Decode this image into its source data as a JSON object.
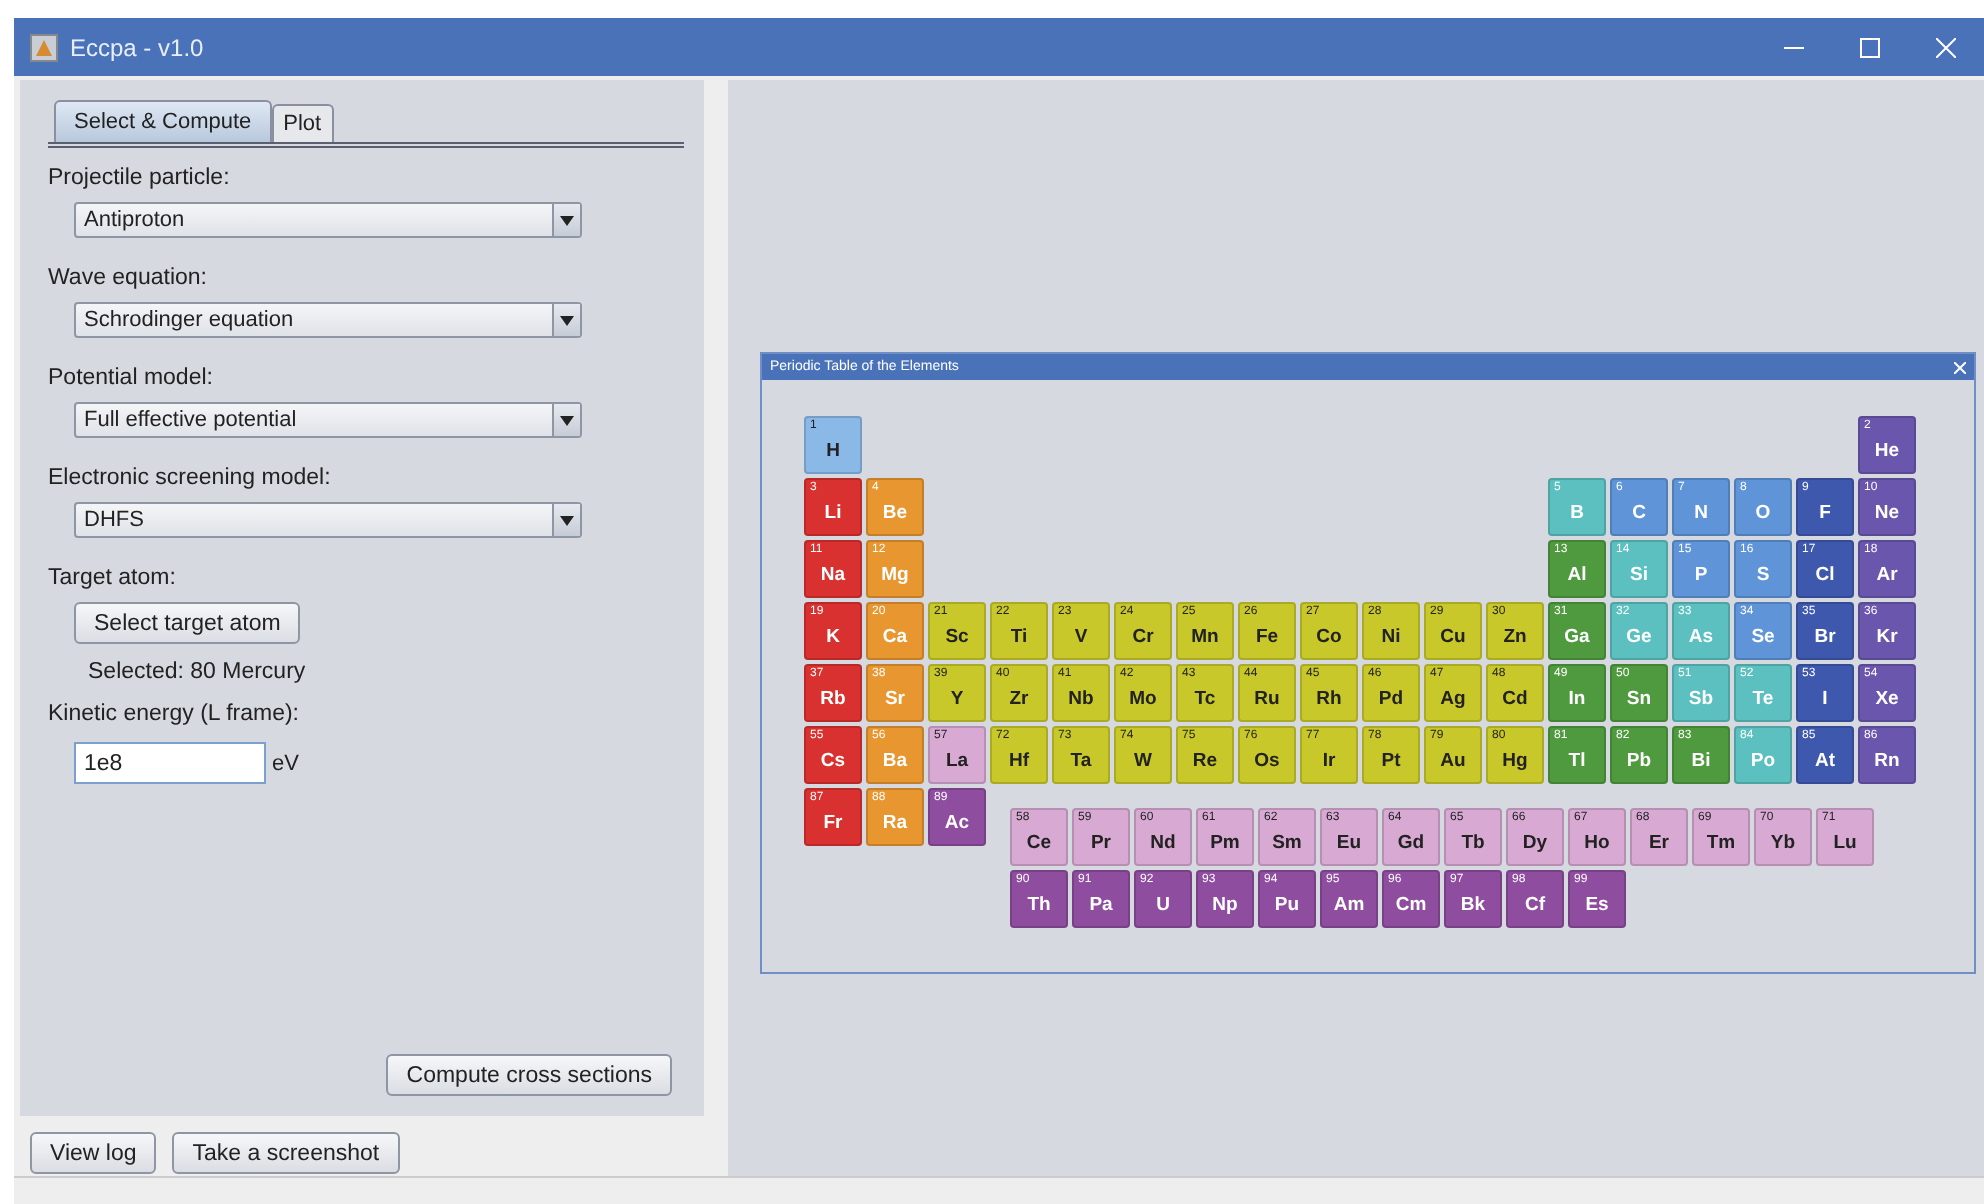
{
  "window": {
    "title": "Eccpa - v1.0"
  },
  "tabs": [
    {
      "label": "Select & Compute",
      "selected": true
    },
    {
      "label": "Plot",
      "selected": false
    }
  ],
  "fields": [
    {
      "label": "Projectile particle:",
      "value": "Antiproton"
    },
    {
      "label": "Wave equation:",
      "value": "Schrodinger equation"
    },
    {
      "label": "Potential model:",
      "value": "Full effective potential"
    },
    {
      "label": "Electronic screening model:",
      "value": "DHFS"
    }
  ],
  "target": {
    "label": "Target atom:",
    "button": "Select target atom",
    "selected_text": "Selected: 80 Mercury"
  },
  "energy": {
    "label": "Kinetic energy (L frame):",
    "value": "1e8",
    "unit": "eV"
  },
  "compute_button": "Compute cross sections",
  "bottom_buttons": [
    "View log",
    "Take a screenshot"
  ],
  "periodic_window": {
    "title": "Periodic Table of the Elements",
    "rows": [
      {
        "left": [
          {
            "number": "1",
            "symbol": "H",
            "color": "#8ab9e8"
          }
        ],
        "right": [
          {
            "number": "2",
            "symbol": "He",
            "color": "#6a56ad"
          }
        ]
      },
      {
        "left": [
          {
            "number": "3",
            "symbol": "Li",
            "color": "#d9312f"
          },
          {
            "number": "4",
            "symbol": "Be",
            "color": "#e8962f"
          }
        ],
        "right": [
          {
            "number": "5",
            "symbol": "B",
            "color": "#5cc0c0"
          },
          {
            "number": "6",
            "symbol": "C",
            "color": "#5f95d8"
          },
          {
            "number": "7",
            "symbol": "N",
            "color": "#5f95d8"
          },
          {
            "number": "8",
            "symbol": "O",
            "color": "#5f95d8"
          },
          {
            "number": "9",
            "symbol": "F",
            "color": "#3e58ae"
          },
          {
            "number": "10",
            "symbol": "Ne",
            "color": "#6a56ad"
          }
        ]
      },
      {
        "left": [
          {
            "number": "11",
            "symbol": "Na",
            "color": "#d9312f"
          },
          {
            "number": "12",
            "symbol": "Mg",
            "color": "#e8962f"
          }
        ],
        "right": [
          {
            "number": "13",
            "symbol": "Al",
            "color": "#4f9a3f"
          },
          {
            "number": "14",
            "symbol": "Si",
            "color": "#5cc0c0"
          },
          {
            "number": "15",
            "symbol": "P",
            "color": "#5f95d8"
          },
          {
            "number": "16",
            "symbol": "S",
            "color": "#5f95d8"
          },
          {
            "number": "17",
            "symbol": "Cl",
            "color": "#3e58ae"
          },
          {
            "number": "18",
            "symbol": "Ar",
            "color": "#6a56ad"
          }
        ]
      },
      {
        "left": [
          {
            "number": "19",
            "symbol": "K",
            "color": "#d9312f"
          },
          {
            "number": "20",
            "symbol": "Ca",
            "color": "#e8962f"
          },
          {
            "number": "21",
            "symbol": "Sc",
            "color": "#c9c82a"
          },
          {
            "number": "22",
            "symbol": "Ti",
            "color": "#c9c82a"
          },
          {
            "number": "23",
            "symbol": "V",
            "color": "#c9c82a"
          },
          {
            "number": "24",
            "symbol": "Cr",
            "color": "#c9c82a"
          },
          {
            "number": "25",
            "symbol": "Mn",
            "color": "#c9c82a"
          },
          {
            "number": "26",
            "symbol": "Fe",
            "color": "#c9c82a"
          },
          {
            "number": "27",
            "symbol": "Co",
            "color": "#c9c82a"
          },
          {
            "number": "28",
            "symbol": "Ni",
            "color": "#c9c82a"
          },
          {
            "number": "29",
            "symbol": "Cu",
            "color": "#c9c82a"
          },
          {
            "number": "30",
            "symbol": "Zn",
            "color": "#c9c82a"
          },
          {
            "number": "31",
            "symbol": "Ga",
            "color": "#4f9a3f"
          },
          {
            "number": "32",
            "symbol": "Ge",
            "color": "#5cc0c0"
          },
          {
            "number": "33",
            "symbol": "As",
            "color": "#5cc0c0"
          },
          {
            "number": "34",
            "symbol": "Se",
            "color": "#5f95d8"
          },
          {
            "number": "35",
            "symbol": "Br",
            "color": "#3e58ae"
          },
          {
            "number": "36",
            "symbol": "Kr",
            "color": "#6a56ad"
          }
        ],
        "right": []
      },
      {
        "left": [
          {
            "number": "37",
            "symbol": "Rb",
            "color": "#d9312f"
          },
          {
            "number": "38",
            "symbol": "Sr",
            "color": "#e8962f"
          },
          {
            "number": "39",
            "symbol": "Y",
            "color": "#c9c82a"
          },
          {
            "number": "40",
            "symbol": "Zr",
            "color": "#c9c82a"
          },
          {
            "number": "41",
            "symbol": "Nb",
            "color": "#c9c82a"
          },
          {
            "number": "42",
            "symbol": "Mo",
            "color": "#c9c82a"
          },
          {
            "number": "43",
            "symbol": "Tc",
            "color": "#c9c82a"
          },
          {
            "number": "44",
            "symbol": "Ru",
            "color": "#c9c82a"
          },
          {
            "number": "45",
            "symbol": "Rh",
            "color": "#c9c82a"
          },
          {
            "number": "46",
            "symbol": "Pd",
            "color": "#c9c82a"
          },
          {
            "number": "47",
            "symbol": "Ag",
            "color": "#c9c82a"
          },
          {
            "number": "48",
            "symbol": "Cd",
            "color": "#c9c82a"
          },
          {
            "number": "49",
            "symbol": "In",
            "color": "#4f9a3f"
          },
          {
            "number": "50",
            "symbol": "Sn",
            "color": "#4f9a3f"
          },
          {
            "number": "51",
            "symbol": "Sb",
            "color": "#5cc0c0"
          },
          {
            "number": "52",
            "symbol": "Te",
            "color": "#5cc0c0"
          },
          {
            "number": "53",
            "symbol": "I",
            "color": "#3e58ae"
          },
          {
            "number": "54",
            "symbol": "Xe",
            "color": "#6a56ad"
          }
        ],
        "right": []
      },
      {
        "left": [
          {
            "number": "55",
            "symbol": "Cs",
            "color": "#d9312f"
          },
          {
            "number": "56",
            "symbol": "Ba",
            "color": "#e8962f"
          },
          {
            "number": "57",
            "symbol": "La",
            "color": "#d7a9d3"
          },
          {
            "number": "72",
            "symbol": "Hf",
            "color": "#c9c82a"
          },
          {
            "number": "73",
            "symbol": "Ta",
            "color": "#c9c82a"
          },
          {
            "number": "74",
            "symbol": "W",
            "color": "#c9c82a"
          },
          {
            "number": "75",
            "symbol": "Re",
            "color": "#c9c82a"
          },
          {
            "number": "76",
            "symbol": "Os",
            "color": "#c9c82a"
          },
          {
            "number": "77",
            "symbol": "Ir",
            "color": "#c9c82a"
          },
          {
            "number": "78",
            "symbol": "Pt",
            "color": "#c9c82a"
          },
          {
            "number": "79",
            "symbol": "Au",
            "color": "#c9c82a"
          },
          {
            "number": "80",
            "symbol": "Hg",
            "color": "#c9c82a"
          },
          {
            "number": "81",
            "symbol": "Tl",
            "color": "#4f9a3f"
          },
          {
            "number": "82",
            "symbol": "Pb",
            "color": "#4f9a3f"
          },
          {
            "number": "83",
            "symbol": "Bi",
            "color": "#4f9a3f"
          },
          {
            "number": "84",
            "symbol": "Po",
            "color": "#5cc0c0"
          },
          {
            "number": "85",
            "symbol": "At",
            "color": "#3e58ae"
          },
          {
            "number": "86",
            "symbol": "Rn",
            "color": "#6a56ad"
          }
        ],
        "right": []
      },
      {
        "left": [
          {
            "number": "87",
            "symbol": "Fr",
            "color": "#d9312f"
          },
          {
            "number": "88",
            "symbol": "Ra",
            "color": "#e8962f"
          },
          {
            "number": "89",
            "symbol": "Ac",
            "color": "#8e4d9e"
          }
        ],
        "right": []
      }
    ],
    "f_rows": [
      [
        {
          "number": "58",
          "symbol": "Ce",
          "color": "#d7a9d3"
        },
        {
          "number": "59",
          "symbol": "Pr",
          "color": "#d7a9d3"
        },
        {
          "number": "60",
          "symbol": "Nd",
          "color": "#d7a9d3"
        },
        {
          "number": "61",
          "symbol": "Pm",
          "color": "#d7a9d3"
        },
        {
          "number": "62",
          "symbol": "Sm",
          "color": "#d7a9d3"
        },
        {
          "number": "63",
          "symbol": "Eu",
          "color": "#d7a9d3"
        },
        {
          "number": "64",
          "symbol": "Gd",
          "color": "#d7a9d3"
        },
        {
          "number": "65",
          "symbol": "Tb",
          "color": "#d7a9d3"
        },
        {
          "number": "66",
          "symbol": "Dy",
          "color": "#d7a9d3"
        },
        {
          "number": "67",
          "symbol": "Ho",
          "color": "#d7a9d3"
        },
        {
          "number": "68",
          "symbol": "Er",
          "color": "#d7a9d3"
        },
        {
          "number": "69",
          "symbol": "Tm",
          "color": "#d7a9d3"
        },
        {
          "number": "70",
          "symbol": "Yb",
          "color": "#d7a9d3"
        },
        {
          "number": "71",
          "symbol": "Lu",
          "color": "#d7a9d3"
        }
      ],
      [
        {
          "number": "90",
          "symbol": "Th",
          "color": "#8e4d9e"
        },
        {
          "number": "91",
          "symbol": "Pa",
          "color": "#8e4d9e"
        },
        {
          "number": "92",
          "symbol": "U",
          "color": "#8e4d9e"
        },
        {
          "number": "93",
          "symbol": "Np",
          "color": "#8e4d9e"
        },
        {
          "number": "94",
          "symbol": "Pu",
          "color": "#8e4d9e"
        },
        {
          "number": "95",
          "symbol": "Am",
          "color": "#8e4d9e"
        },
        {
          "number": "96",
          "symbol": "Cm",
          "color": "#8e4d9e"
        },
        {
          "number": "97",
          "symbol": "Bk",
          "color": "#8e4d9e"
        },
        {
          "number": "98",
          "symbol": "Cf",
          "color": "#8e4d9e"
        },
        {
          "number": "99",
          "symbol": "Es",
          "color": "#8e4d9e"
        }
      ]
    ]
  }
}
